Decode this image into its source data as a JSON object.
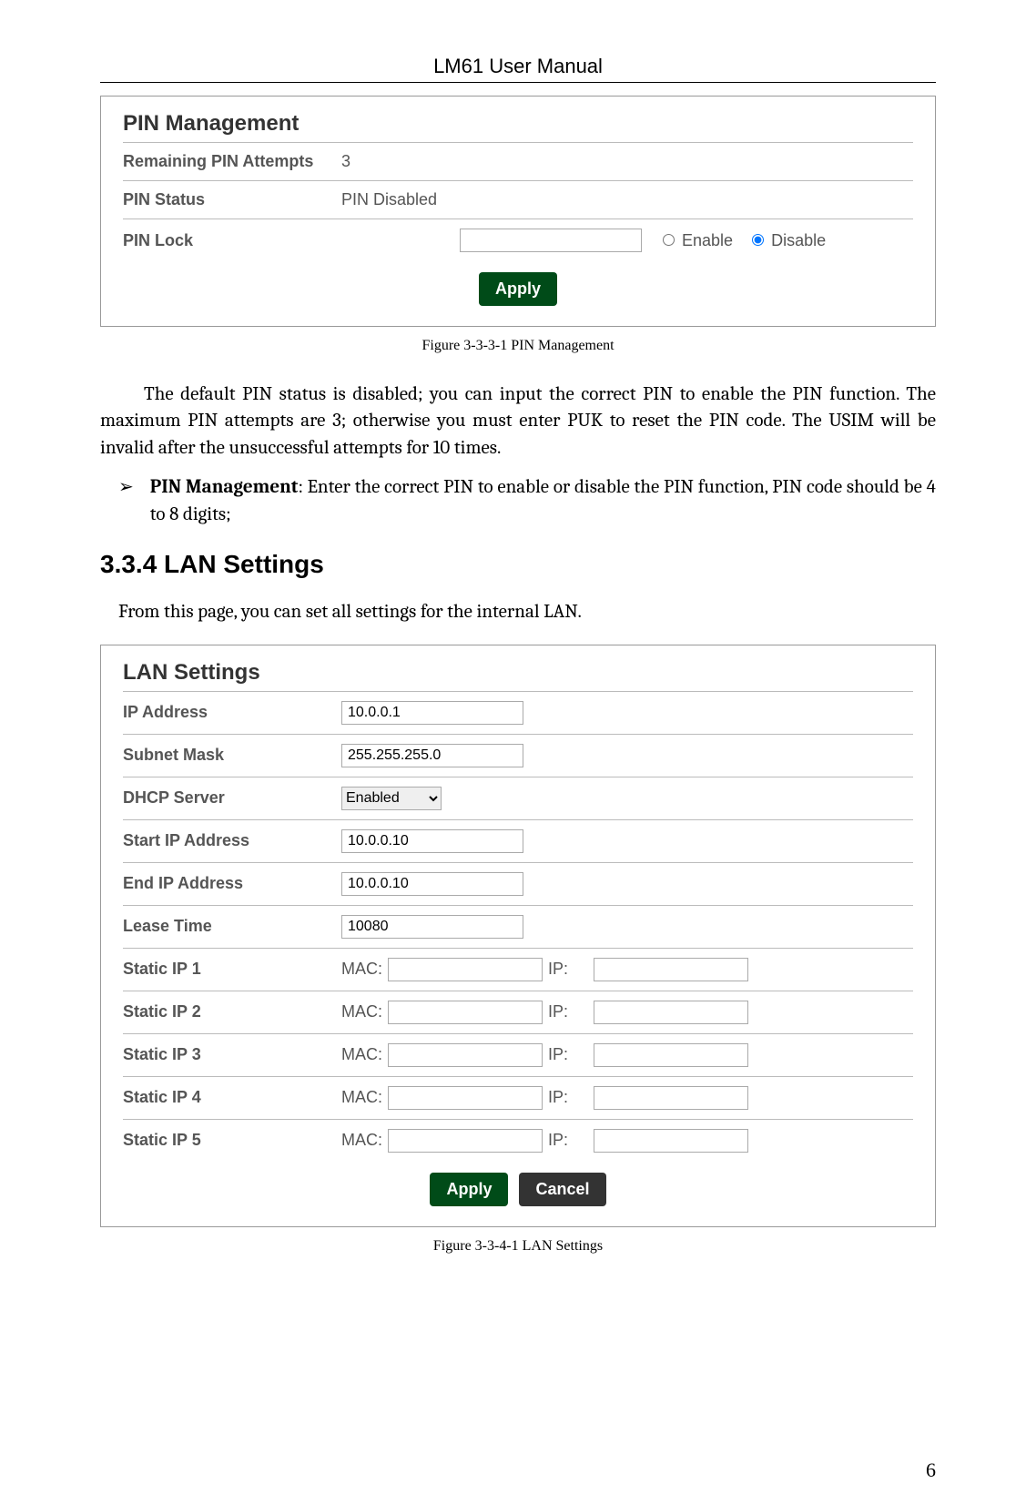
{
  "header": {
    "title": "LM61 User Manual"
  },
  "pin_panel": {
    "title": "PIN Management",
    "rows": {
      "remaining_label": "Remaining PIN Attempts",
      "remaining_value": "3",
      "status_label": "PIN Status",
      "status_value": "PIN Disabled",
      "lock_label": "PIN Lock",
      "enable_label": "Enable",
      "disable_label": "Disable",
      "selected": "disable"
    },
    "apply_label": "Apply",
    "caption": "Figure 3-3-3-1 PIN Management"
  },
  "para1": "The default PIN status is disabled; you can input the correct PIN to enable the PIN function. The maximum PIN attempts are 3; otherwise you must enter PUK to reset the PIN code. The USIM will be invalid after the unsuccessful attempts for 10 times.",
  "bullet": {
    "glyph": "➢",
    "title": "PIN Management",
    "text": ": Enter the correct PIN to enable or disable the PIN function, PIN code should be 4 to 8 digits;"
  },
  "section_heading": "3.3.4 LAN Settings",
  "sub_para": "From this page, you can set all settings for the internal LAN.",
  "lan_panel": {
    "title": "LAN Settings",
    "rows": {
      "ip_label": "IP Address",
      "ip_value": "10.0.0.1",
      "mask_label": "Subnet Mask",
      "mask_value": "255.255.255.0",
      "dhcp_label": "DHCP Server",
      "dhcp_value": "Enabled",
      "start_label": "Start IP Address",
      "start_value": "10.0.0.10",
      "end_label": "End IP Address",
      "end_value": "10.0.0.10",
      "lease_label": "Lease Time",
      "lease_value": "10080",
      "mac_label": "MAC:",
      "ip_sm_label": "IP:",
      "static1_label": "Static IP 1",
      "s1_mac": "",
      "s1_ip": "",
      "static2_label": "Static IP 2",
      "s2_mac": "",
      "s2_ip": "",
      "static3_label": "Static IP 3",
      "s3_mac": "",
      "s3_ip": "",
      "static4_label": "Static IP 4",
      "s4_mac": "",
      "s4_ip": "",
      "static5_label": "Static IP 5",
      "s5_mac": "",
      "s5_ip": ""
    },
    "apply_label": "Apply",
    "cancel_label": "Cancel",
    "caption": "Figure 3-3-4-1 LAN Settings"
  },
  "page_number": "6"
}
